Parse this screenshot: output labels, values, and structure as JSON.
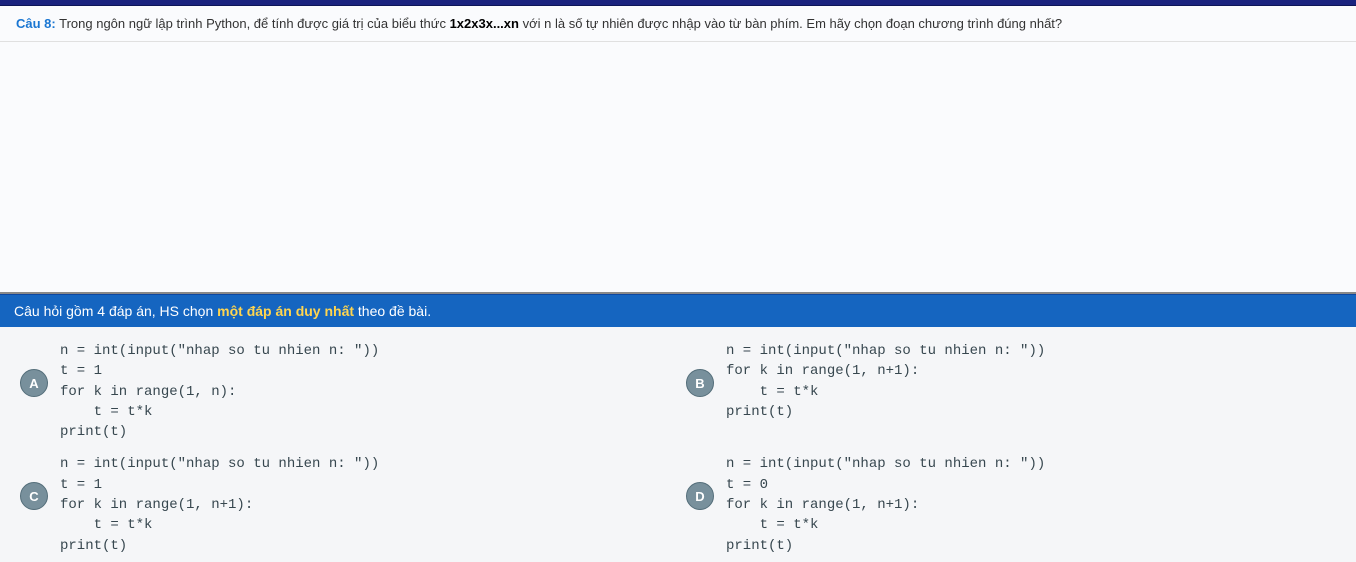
{
  "question": {
    "label": "Câu 8:",
    "text_part1": "Trong ngôn ngữ lập trình Python, để tính được giá trị của biểu thức",
    "formula": "1x2x3x...xn",
    "text_part2": "với n là số tự nhiên được nhập vào từ bàn phím. Em hãy chọn đoạn chương trình đúng nhất?"
  },
  "instruction": {
    "prefix": "Câu hỏi gồm 4 đáp án, HS chọn",
    "highlight": "một đáp án duy nhất",
    "suffix": "theo đề bài."
  },
  "answers": {
    "a": {
      "label": "A",
      "code": "n = int(input(\"nhap so tu nhien n: \"))\nt = 1\nfor k in range(1, n):\n    t = t*k\nprint(t)"
    },
    "b": {
      "label": "B",
      "code": "n = int(input(\"nhap so tu nhien n: \"))\nfor k in range(1, n+1):\n    t = t*k\nprint(t)"
    },
    "c": {
      "label": "C",
      "code": "n = int(input(\"nhap so tu nhien n: \"))\nt = 1\nfor k in range(1, n+1):\n    t = t*k\nprint(t)"
    },
    "d": {
      "label": "D",
      "code": "n = int(input(\"nhap so tu nhien n: \"))\nt = 0\nfor k in range(1, n+1):\n    t = t*k\nprint(t)"
    }
  }
}
